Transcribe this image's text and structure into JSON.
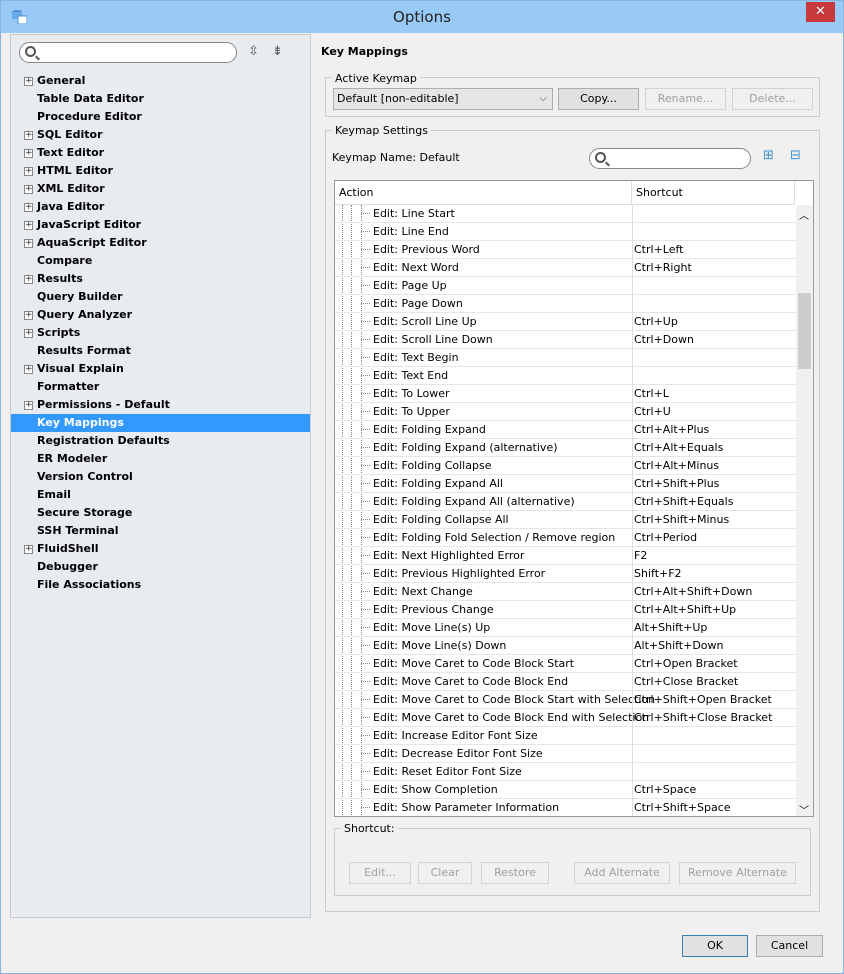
{
  "window": {
    "title": "Options",
    "close": "✕"
  },
  "sidebar": {
    "items": [
      {
        "label": "General",
        "exp": true
      },
      {
        "label": "Table Data Editor",
        "exp": false
      },
      {
        "label": "Procedure Editor",
        "exp": false
      },
      {
        "label": "SQL Editor",
        "exp": true
      },
      {
        "label": "Text Editor",
        "exp": true
      },
      {
        "label": "HTML Editor",
        "exp": true
      },
      {
        "label": "XML Editor",
        "exp": true
      },
      {
        "label": "Java Editor",
        "exp": true
      },
      {
        "label": "JavaScript Editor",
        "exp": true
      },
      {
        "label": "AquaScript Editor",
        "exp": true
      },
      {
        "label": "Compare",
        "exp": false
      },
      {
        "label": "Results",
        "exp": true
      },
      {
        "label": "Query Builder",
        "exp": false
      },
      {
        "label": "Query Analyzer",
        "exp": true
      },
      {
        "label": "Scripts",
        "exp": true
      },
      {
        "label": "Results Format",
        "exp": false
      },
      {
        "label": "Visual Explain",
        "exp": true
      },
      {
        "label": "Formatter",
        "exp": false
      },
      {
        "label": "Permissions - Default",
        "exp": true
      },
      {
        "label": "Key Mappings",
        "exp": false,
        "selected": true
      },
      {
        "label": "Registration Defaults",
        "exp": false
      },
      {
        "label": "ER Modeler",
        "exp": false
      },
      {
        "label": "Version Control",
        "exp": false
      },
      {
        "label": "Email",
        "exp": false
      },
      {
        "label": "Secure Storage",
        "exp": false
      },
      {
        "label": "SSH Terminal",
        "exp": false
      },
      {
        "label": "FluidShell",
        "exp": true
      },
      {
        "label": "Debugger",
        "exp": false
      },
      {
        "label": "File Associations",
        "exp": false
      }
    ]
  },
  "main": {
    "heading": "Key Mappings",
    "active_keymap": {
      "legend": "Active Keymap",
      "selected": "Default [non-editable]",
      "copy": "Copy...",
      "rename": "Rename...",
      "delete": "Delete..."
    },
    "keymap_settings": {
      "legend": "Keymap Settings",
      "name_label": "Keymap Name: Default"
    },
    "table": {
      "headers": [
        "Action",
        "Shortcut"
      ],
      "rows": [
        [
          "Edit: Line Start",
          ""
        ],
        [
          "Edit: Line End",
          ""
        ],
        [
          "Edit: Previous Word",
          "Ctrl+Left"
        ],
        [
          "Edit: Next Word",
          "Ctrl+Right"
        ],
        [
          "Edit: Page Up",
          ""
        ],
        [
          "Edit: Page Down",
          ""
        ],
        [
          "Edit: Scroll Line Up",
          "Ctrl+Up"
        ],
        [
          "Edit: Scroll Line Down",
          "Ctrl+Down"
        ],
        [
          "Edit: Text Begin",
          ""
        ],
        [
          "Edit: Text End",
          ""
        ],
        [
          "Edit: To Lower",
          "Ctrl+L"
        ],
        [
          "Edit: To Upper",
          "Ctrl+U"
        ],
        [
          "Edit: Folding Expand",
          "Ctrl+Alt+Plus"
        ],
        [
          "Edit: Folding Expand (alternative)",
          "Ctrl+Alt+Equals"
        ],
        [
          "Edit: Folding Collapse",
          "Ctrl+Alt+Minus"
        ],
        [
          "Edit: Folding Expand All",
          "Ctrl+Shift+Plus"
        ],
        [
          "Edit: Folding Expand All (alternative)",
          "Ctrl+Shift+Equals"
        ],
        [
          "Edit: Folding Collapse All",
          "Ctrl+Shift+Minus"
        ],
        [
          "Edit: Folding Fold Selection / Remove region",
          "Ctrl+Period"
        ],
        [
          "Edit: Next Highlighted Error",
          "F2"
        ],
        [
          "Edit: Previous Highlighted Error",
          "Shift+F2"
        ],
        [
          "Edit: Next Change",
          "Ctrl+Alt+Shift+Down"
        ],
        [
          "Edit: Previous Change",
          "Ctrl+Alt+Shift+Up"
        ],
        [
          "Edit: Move Line(s) Up",
          "Alt+Shift+Up"
        ],
        [
          "Edit: Move Line(s) Down",
          "Alt+Shift+Down"
        ],
        [
          "Edit: Move Caret to Code Block Start",
          "Ctrl+Open Bracket"
        ],
        [
          "Edit: Move Caret to Code Block End",
          "Ctrl+Close Bracket"
        ],
        [
          "Edit: Move Caret to Code Block Start with Selection",
          "Ctrl+Shift+Open Bracket"
        ],
        [
          "Edit: Move Caret to Code Block End with Selection",
          "Ctrl+Shift+Close Bracket"
        ],
        [
          "Edit: Increase Editor Font Size",
          ""
        ],
        [
          "Edit: Decrease Editor Font Size",
          ""
        ],
        [
          "Edit: Reset Editor Font Size",
          ""
        ],
        [
          "Edit: Show Completion",
          "Ctrl+Space"
        ],
        [
          "Edit: Show Parameter Information",
          "Ctrl+Shift+Space"
        ]
      ]
    },
    "shortcut": {
      "legend": "Shortcut:",
      "edit": "Edit...",
      "clear": "Clear",
      "restore": "Restore",
      "add_alternate": "Add Alternate",
      "remove_alternate": "Remove Alternate"
    }
  },
  "footer": {
    "ok": "OK",
    "cancel": "Cancel"
  }
}
